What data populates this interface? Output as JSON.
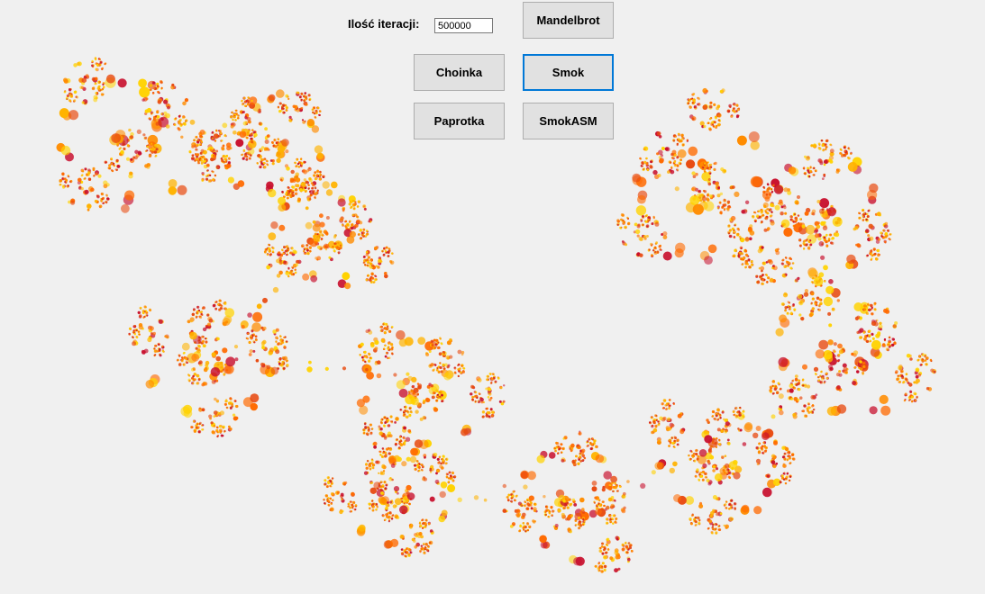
{
  "form": {
    "iterations_label": "Ilość iteracji:",
    "iterations_value": "500000"
  },
  "buttons": {
    "mandelbrot": "Mandelbrot",
    "choinka": "Choinka",
    "smok": "Smok",
    "paprotka": "Paprotka",
    "smokasm": "SmokASM"
  },
  "fractal": {
    "type": "twindragon-like dragon fractal",
    "colors": [
      "#ffd200",
      "#ffb300",
      "#ff8c00",
      "#ff6a00",
      "#e84a10",
      "#c8102e"
    ]
  }
}
